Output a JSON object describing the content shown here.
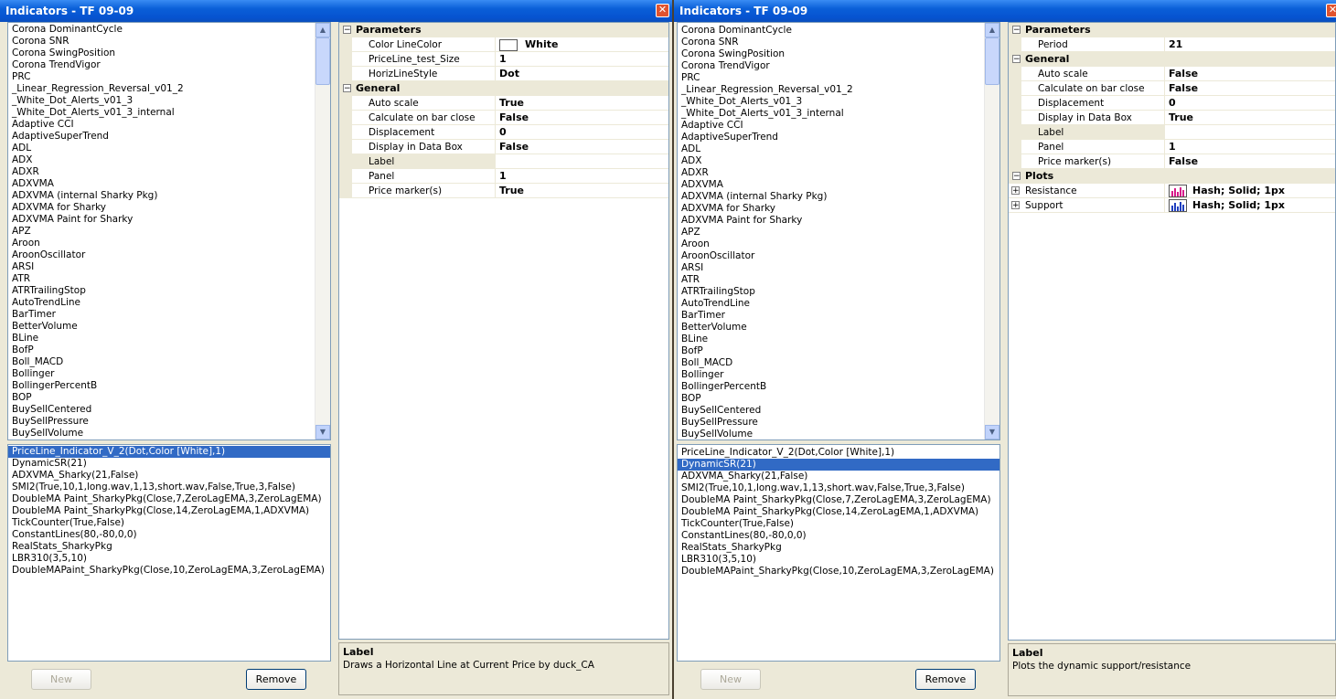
{
  "left": {
    "title": "Indicators - TF 09-09",
    "available": [
      "Corona DominantCycle",
      "Corona SNR",
      "Corona SwingPosition",
      "Corona TrendVigor",
      "PRC",
      "_Linear_Regression_Reversal_v01_2",
      "_White_Dot_Alerts_v01_3",
      "_White_Dot_Alerts_v01_3_internal",
      "Adaptive CCI",
      "AdaptiveSuperTrend",
      "ADL",
      "ADX",
      "ADXR",
      "ADXVMA",
      "ADXVMA (internal Sharky Pkg)",
      "ADXVMA for Sharky",
      "ADXVMA Paint for Sharky",
      "APZ",
      "Aroon",
      "AroonOscillator",
      "ARSI",
      "ATR",
      "ATRTrailingStop",
      "AutoTrendLine",
      "BarTimer",
      "BetterVolume",
      "BLine",
      "BofP",
      "Boll_MACD",
      "Bollinger",
      "BollingerPercentB",
      "BOP",
      "BuySellCentered",
      "BuySellPressure",
      "BuySellVolume"
    ],
    "applied": [
      "PriceLine_Indicator_V_2(Dot,Color [White],1)",
      "DynamicSR(21)",
      "ADXVMA_Sharky(21,False)",
      "SMI2(True,10,1,long.wav,1,13,short.wav,False,True,3,False)",
      "DoubleMA Paint_SharkyPkg(Close,7,ZeroLagEMA,3,ZeroLagEMA)",
      "DoubleMA Paint_SharkyPkg(Close,14,ZeroLagEMA,1,ADXVMA)",
      "TickCounter(True,False)",
      "ConstantLines(80,-80,0,0)",
      "RealStats_SharkyPkg",
      "LBR310(3,5,10)",
      "DoubleMAPaint_SharkyPkg(Close,10,ZeroLagEMA,3,ZeroLagEMA)"
    ],
    "selected_index": 0,
    "cat_parameters": "Parameters",
    "cat_general": "General",
    "params": [
      {
        "name": "Color LineColor",
        "value": "White",
        "swatch": "#ffffff"
      },
      {
        "name": "PriceLine_test_Size",
        "value": "1"
      },
      {
        "name": "HorizLineStyle",
        "value": "Dot"
      }
    ],
    "general": [
      {
        "name": "Auto scale",
        "value": "True"
      },
      {
        "name": "Calculate on bar close",
        "value": "False"
      },
      {
        "name": "Displacement",
        "value": "0"
      },
      {
        "name": "Display in Data Box",
        "value": "False"
      },
      {
        "name": "Label",
        "value": "",
        "selected": true
      },
      {
        "name": "Panel",
        "value": "1"
      },
      {
        "name": "Price marker(s)",
        "value": "True"
      }
    ],
    "desc_title": "Label",
    "desc_text": "Draws a Horizontal Line at Current Price by duck_CA",
    "new_label": "New",
    "remove_label": "Remove"
  },
  "right": {
    "title": "Indicators - TF 09-09",
    "selected_index": 1,
    "cat_parameters": "Parameters",
    "cat_general": "General",
    "cat_plots": "Plots",
    "params": [
      {
        "name": "Period",
        "value": "21"
      }
    ],
    "general": [
      {
        "name": "Auto scale",
        "value": "False"
      },
      {
        "name": "Calculate on bar close",
        "value": "False"
      },
      {
        "name": "Displacement",
        "value": "0"
      },
      {
        "name": "Display in Data Box",
        "value": "True"
      },
      {
        "name": "Label",
        "value": "",
        "selected": true
      },
      {
        "name": "Panel",
        "value": "1"
      },
      {
        "name": "Price marker(s)",
        "value": "False"
      }
    ],
    "plots": [
      {
        "name": "Resistance",
        "value": "Hash; Solid; 1px",
        "color": "#d81b8a"
      },
      {
        "name": "Support",
        "value": "Hash; Solid; 1px",
        "color": "#1f3fbf"
      }
    ],
    "desc_title": "Label",
    "desc_text": "Plots the dynamic support/resistance",
    "new_label": "New",
    "remove_label": "Remove"
  },
  "icons": {
    "close": "close-icon",
    "scroll_up": "scroll-up-icon",
    "scroll_down": "scroll-down-icon",
    "collapse": "collapse-icon",
    "expand": "expand-icon"
  }
}
